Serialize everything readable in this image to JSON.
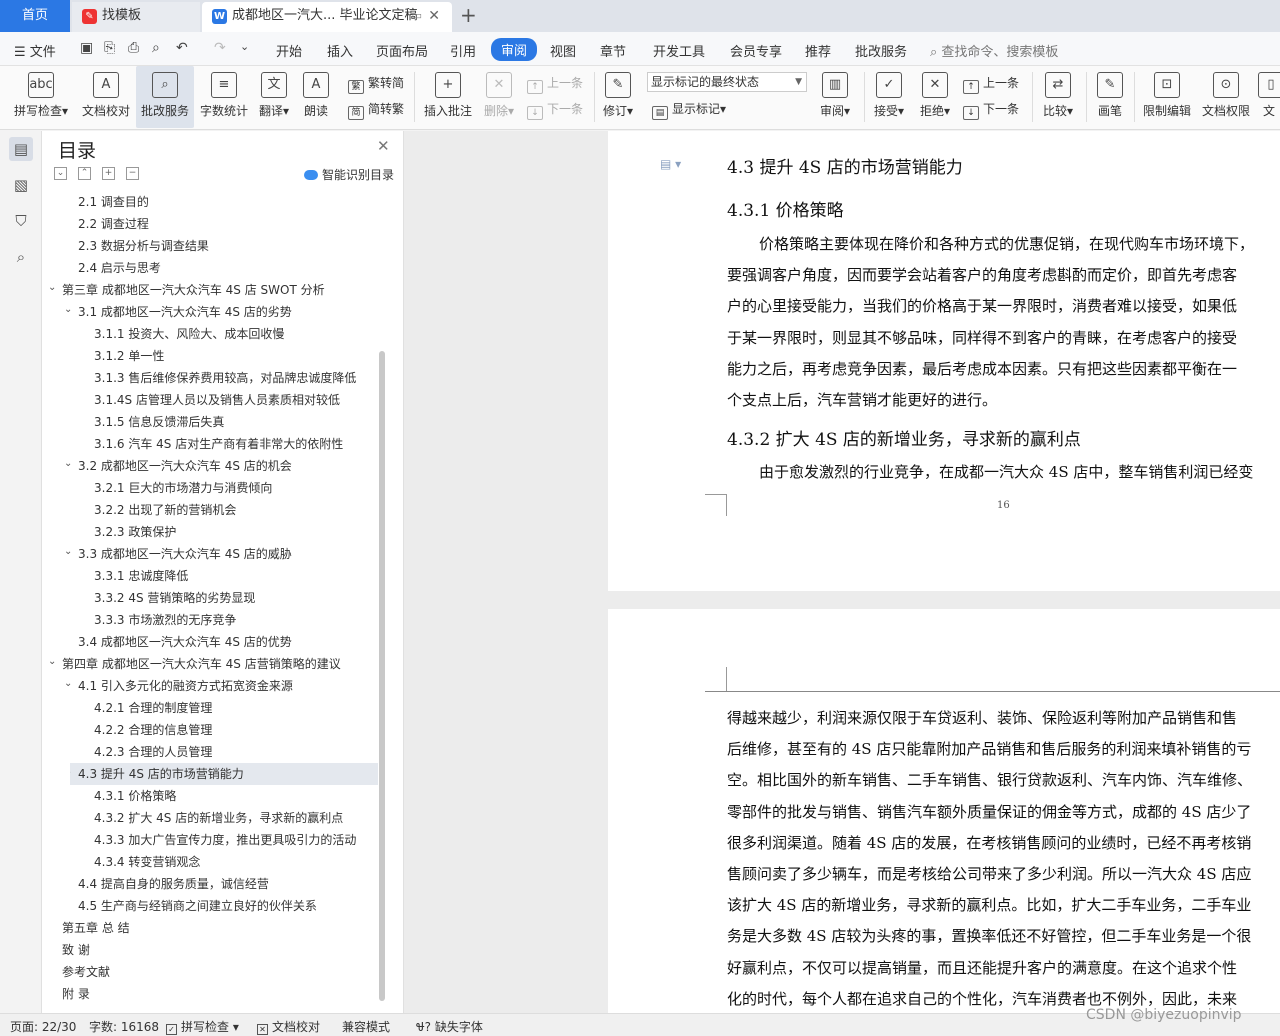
{
  "tabs": {
    "home": "首页",
    "template": "找模板",
    "document": "成都地区一汽大... 毕业论文定稿"
  },
  "menu": {
    "file": "文件",
    "items": [
      "开始",
      "插入",
      "页面布局",
      "引用",
      "审阅",
      "视图",
      "章节",
      "开发工具",
      "会员专享",
      "推荐",
      "批改服务"
    ],
    "active": "审阅",
    "search_placeholder": "查找命令、搜索模板"
  },
  "ribbon": {
    "spellcheck": "拼写检查",
    "doc_proof": "文档校对",
    "review_service": "批改服务",
    "word_count": "字数统计",
    "translate": "翻译",
    "read_aloud": "朗读",
    "trad_conv": "繁转简",
    "simp_conv": "简转繁",
    "insert_comment": "插入批注",
    "delete": "删除",
    "prev": "上一条",
    "next": "下一条",
    "track": "修订",
    "markup_state": "显示标记的最终状态",
    "show_markup": "显示标记",
    "review": "审阅",
    "accept": "接受",
    "reject": "拒绝",
    "prev2": "上一条",
    "next2": "下一条",
    "compare": "比较",
    "pen": "画笔",
    "restrict_edit": "限制编辑",
    "doc_rights": "文档权限",
    "doc_cut": "文"
  },
  "toc": {
    "title": "目录",
    "smart": "智能识别目录",
    "items": [
      {
        "text": "2.1 调查目的",
        "level": 2
      },
      {
        "text": "2.2 调查过程",
        "level": 2
      },
      {
        "text": "2.3 数据分析与调查结果",
        "level": 2
      },
      {
        "text": "2.4 启示与思考",
        "level": 2
      },
      {
        "text": "第三章  成都地区一汽大众汽车 4S 店 SWOT 分析",
        "level": 1,
        "expanded": true
      },
      {
        "text": "3.1 成都地区一汽大众汽车 4S 店的劣势",
        "level": 2,
        "expanded": true
      },
      {
        "text": "3.1.1 投资大、风险大、成本回收慢",
        "level": 3
      },
      {
        "text": "3.1.2 单一性",
        "level": 3
      },
      {
        "text": "3.1.3 售后维修保养费用较高，对品牌忠诚度降低",
        "level": 3
      },
      {
        "text": "3.1.4S 店管理人员以及销售人员素质相对较低",
        "level": 3
      },
      {
        "text": "3.1.5 信息反馈滞后失真",
        "level": 3
      },
      {
        "text": "3.1.6 汽车 4S 店对生产商有着非常大的依附性",
        "level": 3
      },
      {
        "text": "3.2 成都地区一汽大众汽车 4S 店的机会",
        "level": 2,
        "expanded": true
      },
      {
        "text": "3.2.1 巨大的市场潜力与消费倾向",
        "level": 3
      },
      {
        "text": "3.2.2 出现了新的营销机会",
        "level": 3
      },
      {
        "text": "3.2.3 政策保护",
        "level": 3
      },
      {
        "text": "3.3 成都地区一汽大众汽车 4S 店的威胁",
        "level": 2,
        "expanded": true
      },
      {
        "text": "3.3.1 忠诚度降低",
        "level": 3
      },
      {
        "text": "3.3.2 4S 营销策略的劣势显现",
        "level": 3
      },
      {
        "text": "3.3.3 市场激烈的无序竞争",
        "level": 3
      },
      {
        "text": "3.4 成都地区一汽大众汽车 4S 店的优势",
        "level": 2
      },
      {
        "text": "第四章  成都地区一汽大众汽车 4S 店营销策略的建议",
        "level": 1,
        "expanded": true
      },
      {
        "text": "4.1  引入多元化的融资方式拓宽资金来源",
        "level": 2,
        "expanded": true
      },
      {
        "text": "4.2.1  合理的制度管理",
        "level": 3
      },
      {
        "text": "4.2.2  合理的信息管理",
        "level": 3
      },
      {
        "text": "4.2.3  合理的人员管理",
        "level": 3
      },
      {
        "text": "4.3  提升 4S 店的市场营销能力",
        "level": 2,
        "expanded": true,
        "highlight": true
      },
      {
        "text": "4.3.1  价格策略",
        "level": 3
      },
      {
        "text": "4.3.2  扩大 4S 店的新增业务，寻求新的赢利点",
        "level": 3
      },
      {
        "text": "4.3.3  加大广告宣传力度，推出更具吸引力的活动",
        "level": 3
      },
      {
        "text": "4.3.4  转变营销观念",
        "level": 3
      },
      {
        "text": "4.4  提高自身的服务质量，诚信经营",
        "level": 2
      },
      {
        "text": "4.5  生产商与经销商之间建立良好的伙伴关系",
        "level": 2
      },
      {
        "text": "第五章  总    结",
        "level": 1
      },
      {
        "text": "致    谢",
        "level": 1
      },
      {
        "text": "参考文献",
        "level": 1
      },
      {
        "text": "附    录",
        "level": 1
      }
    ]
  },
  "document": {
    "page1": {
      "heading1": "4.3  提升 4S 店的市场营销能力",
      "heading2": "4.3.1  价格策略",
      "para1": [
        "价格策略主要体现在降价和各种方式的优惠促销，在现代购车市场环境下，",
        "要强调客户角度，因而要学会站着客户的角度考虑斟酌而定价，即首先考虑客",
        "户的心里接受能力，当我们的价格高于某一界限时，消费者难以接受，如果低",
        "于某一界限时，则显其不够品味，同样得不到客户的青睐，在考虑客户的接受",
        "能力之后，再考虑竞争因素，最后考虑成本因素。只有把这些因素都平衡在一",
        "个支点上后，汽车营销才能更好的进行。"
      ],
      "heading3": "4.3.2  扩大 4S 店的新增业务，寻求新的赢利点",
      "para2": [
        "由于愈发激烈的行业竞争，在成都一汽大众 4S 店中，整车销售利润已经变"
      ],
      "page_number": "16"
    },
    "page2": {
      "para": [
        "得越来越少，利润来源仅限于车贷返利、装饰、保险返利等附加产品销售和售",
        "后维修，甚至有的 4S 店只能靠附加产品销售和售后服务的利润来填补销售的亏",
        "空。相比国外的新车销售、二手车销售、银行贷款返利、汽车内饰、汽车维修、",
        "零部件的批发与销售、销售汽车额外质量保证的佣金等方式，成都的 4S 店少了",
        "很多利润渠道。随着 4S 店的发展，在考核销售顾问的业绩时，已经不再考核销",
        "售顾问卖了多少辆车，而是考核给公司带来了多少利润。所以一汽大众 4S 店应",
        "该扩大 4S 店的新增业务，寻求新的赢利点。比如，扩大二手车业务，二手车业",
        "务是大多数 4S 店较为头疼的事，置换率低还不好管控，但二手车业务是一个很",
        "好赢利点，不仅可以提高销量，而且还能提升客户的满意度。在这个追求个性",
        "化的时代，每个人都在追求自己的个性化，汽车消费者也不例外，因此，未来"
      ]
    }
  },
  "status": {
    "page": "页面: 22/30",
    "words": "字数: 16168",
    "spell": "拼写检查",
    "proof": "文档校对",
    "compat": "兼容模式",
    "missing_font": "缺失字体"
  },
  "watermark": "CSDN @biyezuopinvip"
}
